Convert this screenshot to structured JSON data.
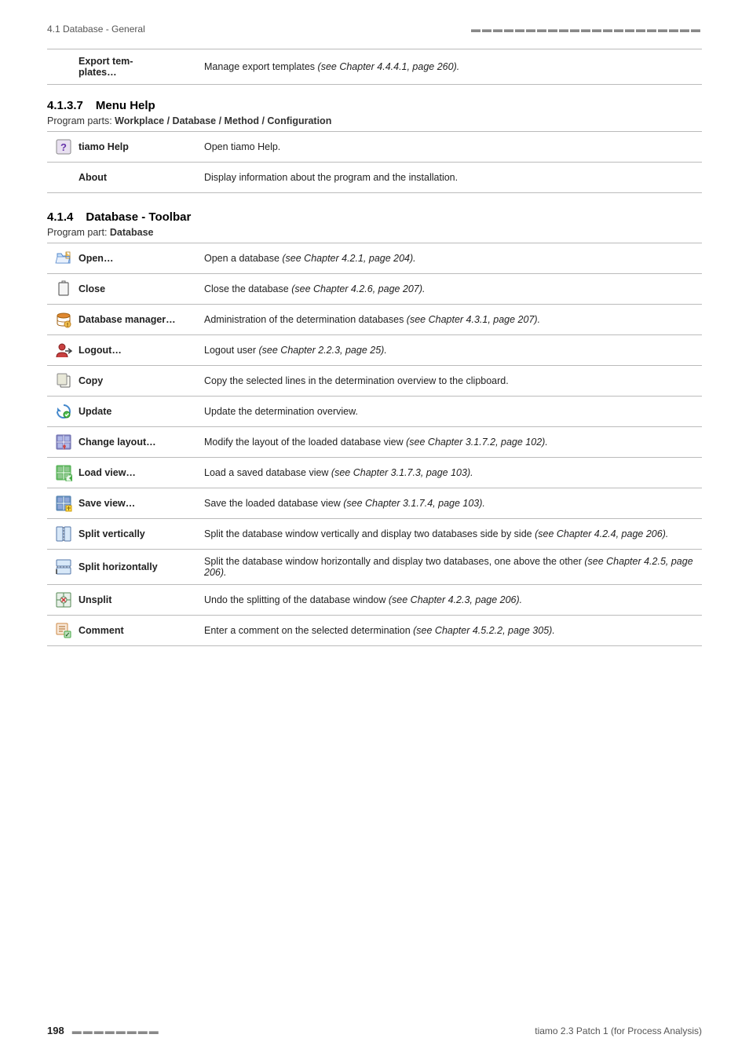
{
  "header": {
    "title": "4.1 Database - General",
    "dots": "▬▬▬▬▬▬▬▬▬▬▬▬▬▬▬▬▬▬▬▬▬"
  },
  "sections": [
    {
      "id": "section-export",
      "rows": [
        {
          "label": "Export tem-\nplates…",
          "description": "Manage export templates ",
          "description_italic": "(see Chapter 4.4.4.1, page 260).",
          "icon": "export-templates"
        }
      ]
    },
    {
      "id": "section-menu-help",
      "number": "4.1.3.7",
      "title": "Menu Help",
      "program_part_prefix": "Program parts: ",
      "program_part_bold": "Workplace / Database / Method / Configuration",
      "rows": [
        {
          "label": "tiamo Help",
          "description": "Open tiamo Help.",
          "icon": "tiamo-help"
        },
        {
          "label": "About",
          "description": "Display information about the program and the installation.",
          "icon": "about"
        }
      ]
    },
    {
      "id": "section-database-toolbar",
      "number": "4.1.4",
      "title": "Database - Toolbar",
      "program_part_prefix": "Program part: ",
      "program_part_bold": "Database",
      "rows": [
        {
          "label": "Open…",
          "description": "Open a database ",
          "description_italic": "(see Chapter 4.2.1, page 204).",
          "icon": "open"
        },
        {
          "label": "Close",
          "description": "Close the database ",
          "description_italic": "(see Chapter 4.2.6, page 207).",
          "icon": "close"
        },
        {
          "label": "Database manager…",
          "description": "Administration of the determination databases ",
          "description_italic": "(see Chapter 4.3.1, page 207).",
          "icon": "database-manager"
        },
        {
          "label": "Logout…",
          "description": "Logout user ",
          "description_italic": "(see Chapter 2.2.3, page 25).",
          "icon": "logout"
        },
        {
          "label": "Copy",
          "description": "Copy the selected lines in the determination overview to the clipboard.",
          "icon": "copy"
        },
        {
          "label": "Update",
          "description": "Update the determination overview.",
          "icon": "update"
        },
        {
          "label": "Change layout…",
          "description": "Modify the layout of the loaded database view ",
          "description_italic": "(see Chapter 3.1.7.2, page 102).",
          "icon": "change-layout"
        },
        {
          "label": "Load view…",
          "description": "Load a saved database view ",
          "description_italic": "(see Chapter 3.1.7.3, page 103).",
          "icon": "load-view"
        },
        {
          "label": "Save view…",
          "description": "Save the loaded database view ",
          "description_italic": "(see Chapter 3.1.7.4, page 103).",
          "icon": "save-view"
        },
        {
          "label": "Split vertically",
          "description": "Split the database window vertically and display two databases side by side ",
          "description_italic": "(see Chapter 4.2.4, page 206).",
          "icon": "split-vertically"
        },
        {
          "label": "Split horizontally",
          "description": "Split the database window horizontally and display two databases, one above the other ",
          "description_italic": "(see Chapter 4.2.5, page 206).",
          "icon": "split-horizontally"
        },
        {
          "label": "Unsplit",
          "description": "Undo the splitting of the database window ",
          "description_italic": "(see Chapter 4.2.3, page 206).",
          "icon": "unsplit"
        },
        {
          "label": "Comment",
          "description": "Enter a comment on the selected determination ",
          "description_italic": "(see Chapter 4.5.2.2, page 305).",
          "icon": "comment"
        }
      ]
    }
  ],
  "footer": {
    "page_number": "198",
    "dots": "▬▬▬▬▬▬▬▬",
    "app_name": "tiamo 2.3 Patch 1 (for Process Analysis)"
  }
}
